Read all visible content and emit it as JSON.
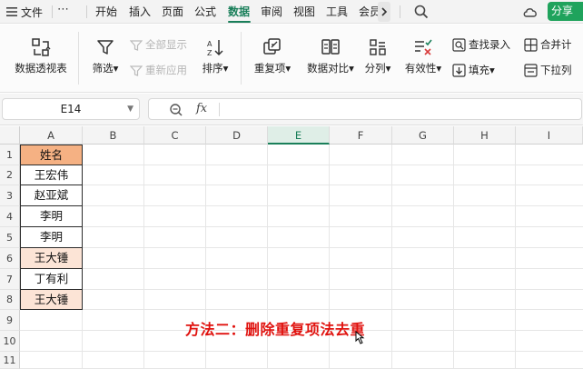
{
  "menubar": {
    "file_label": "文件",
    "more_label": "⋯",
    "tabs": [
      "开始",
      "插入",
      "页面",
      "公式",
      "数据",
      "审阅",
      "视图",
      "工具",
      "会员"
    ],
    "active_tab": "数据",
    "share_label": "分享",
    "accent_color": "#1a7f5a"
  },
  "ribbon": {
    "pivot": "数据透视表",
    "filter": "筛选",
    "show_all": "全部显示",
    "reapply": "重新应用",
    "sort": "排序",
    "duplicates": "重复项",
    "compare": "数据对比",
    "split": "分列",
    "validity": "有效性",
    "find_entry": "查找录入",
    "fill": "填充",
    "merge": "合并计",
    "dropdown": "下拉列"
  },
  "formula_bar": {
    "cell_ref": "E14",
    "fx_label": "fx",
    "formula": ""
  },
  "grid": {
    "columns": [
      "A",
      "B",
      "C",
      "D",
      "E",
      "F",
      "G",
      "H",
      "I"
    ],
    "active_column": "E",
    "rows": [
      "1",
      "2",
      "3",
      "4",
      "5",
      "6",
      "7",
      "8",
      "9",
      "10",
      "11"
    ],
    "column_a": [
      "姓名",
      "王宏伟",
      "赵亚斌",
      "李明",
      "李明",
      "王大锤",
      "丁有利",
      "王大锤"
    ],
    "header_fill": "#f5b183",
    "duplicate_fill": "#fce4d6"
  },
  "caption": {
    "text": "方法二：删除重复项法去重",
    "color": "#e0120e"
  }
}
